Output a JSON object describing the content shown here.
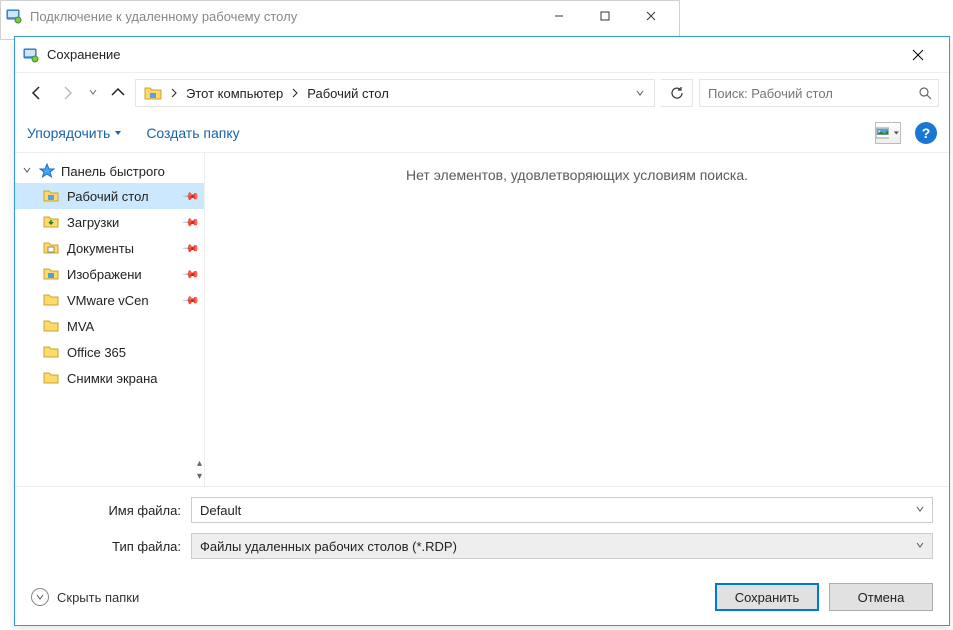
{
  "parent_window": {
    "title": "Подключение к удаленному рабочему столу"
  },
  "dialog": {
    "title": "Сохранение"
  },
  "breadcrumb": {
    "seg1": "Этот компьютер",
    "seg2": "Рабочий стол"
  },
  "search": {
    "placeholder": "Поиск: Рабочий стол"
  },
  "toolbar": {
    "organize": "Упорядочить",
    "new_folder": "Создать папку"
  },
  "sidebar": {
    "root": "Панель быстрого",
    "items": [
      {
        "label": "Рабочий стол",
        "pinned": true,
        "selected": true,
        "icon": "desktop"
      },
      {
        "label": "Загрузки",
        "pinned": true,
        "icon": "downloads"
      },
      {
        "label": "Документы",
        "pinned": true,
        "icon": "documents"
      },
      {
        "label": "Изображени",
        "pinned": true,
        "icon": "pictures"
      },
      {
        "label": "VMware vCen",
        "pinned": true,
        "icon": "folder"
      },
      {
        "label": "MVA",
        "pinned": false,
        "icon": "folder"
      },
      {
        "label": "Office 365",
        "pinned": false,
        "icon": "folder"
      },
      {
        "label": "Снимки экрана",
        "pinned": false,
        "icon": "folder"
      }
    ]
  },
  "content": {
    "empty": "Нет элементов, удовлетворяющих условиям поиска."
  },
  "form": {
    "filename_label": "Имя файла:",
    "filename_value": "Default",
    "filetype_label": "Тип файла:",
    "filetype_value": "Файлы удаленных рабочих столов (*.RDP)"
  },
  "actions": {
    "hide_folders": "Скрыть папки",
    "save": "Сохранить",
    "cancel": "Отмена"
  }
}
